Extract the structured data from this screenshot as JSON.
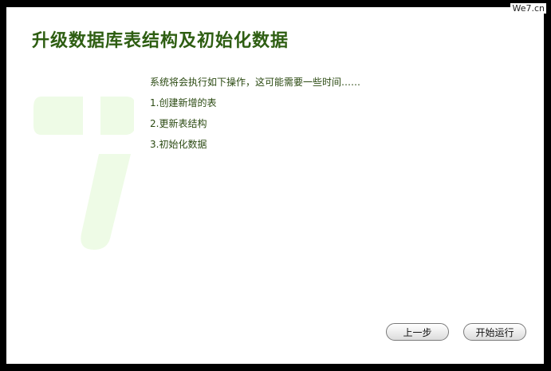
{
  "brand": "We7.cn",
  "header": {
    "title": "升级数据库表结构及初始化数据"
  },
  "content": {
    "intro": "系统将会执行如下操作，这可能需要一些时间……",
    "steps": [
      "1.创建新增的表",
      "2.更新表结构",
      "3.初始化数据"
    ]
  },
  "buttons": {
    "prev_label": "上一步",
    "start_label": "开始运行"
  },
  "colors": {
    "title": "#2e5e12",
    "text": "#2b4a12",
    "logo": "#eefbe6",
    "frame": "#000000",
    "panel": "#ffffff"
  },
  "icons": {
    "watermark": "we7-logo-icon"
  }
}
